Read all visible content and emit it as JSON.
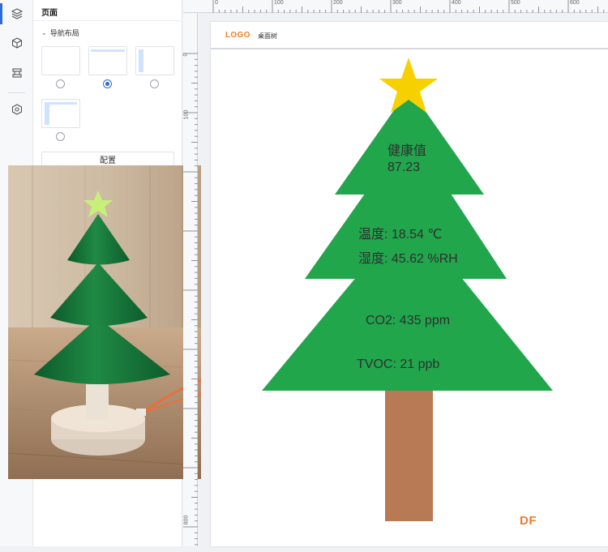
{
  "rail": {
    "items": [
      {
        "icon": "layers-icon",
        "active": true
      },
      {
        "icon": "cube-icon",
        "active": false
      },
      {
        "icon": "stack-icon",
        "active": false
      },
      {
        "icon": "hexagon-settings-icon",
        "active": false
      }
    ]
  },
  "panel": {
    "title": "页面",
    "section_label": "导航布局",
    "layout_options": [
      "top-nav",
      "top-nav-highlight",
      "left-nav",
      "top-left-nav"
    ],
    "selected_layout": 1,
    "config_button": "配置"
  },
  "ruler": {
    "top_labels": [
      "0",
      "100",
      "200",
      "300",
      "400",
      "500",
      "600"
    ],
    "left_labels": [
      "0",
      "100",
      "800"
    ]
  },
  "canvas": {
    "logo": "LOGO",
    "nav_title": "桌面树",
    "health_label": "健康值",
    "health_value": "87.23",
    "temperature": "温度: 18.54 ℃",
    "humidity": "湿度: 45.62 %RH",
    "co2": "CO2: 435 ppm",
    "tvoc": "TVOC:  21  ppb",
    "brand": "DF"
  },
  "colors": {
    "tree_green": "#21a64c",
    "trunk_brown": "#b87a55",
    "star_yellow": "#f7d000",
    "accent_blue": "#2f6bd8",
    "logo_orange": "#f0802b"
  }
}
